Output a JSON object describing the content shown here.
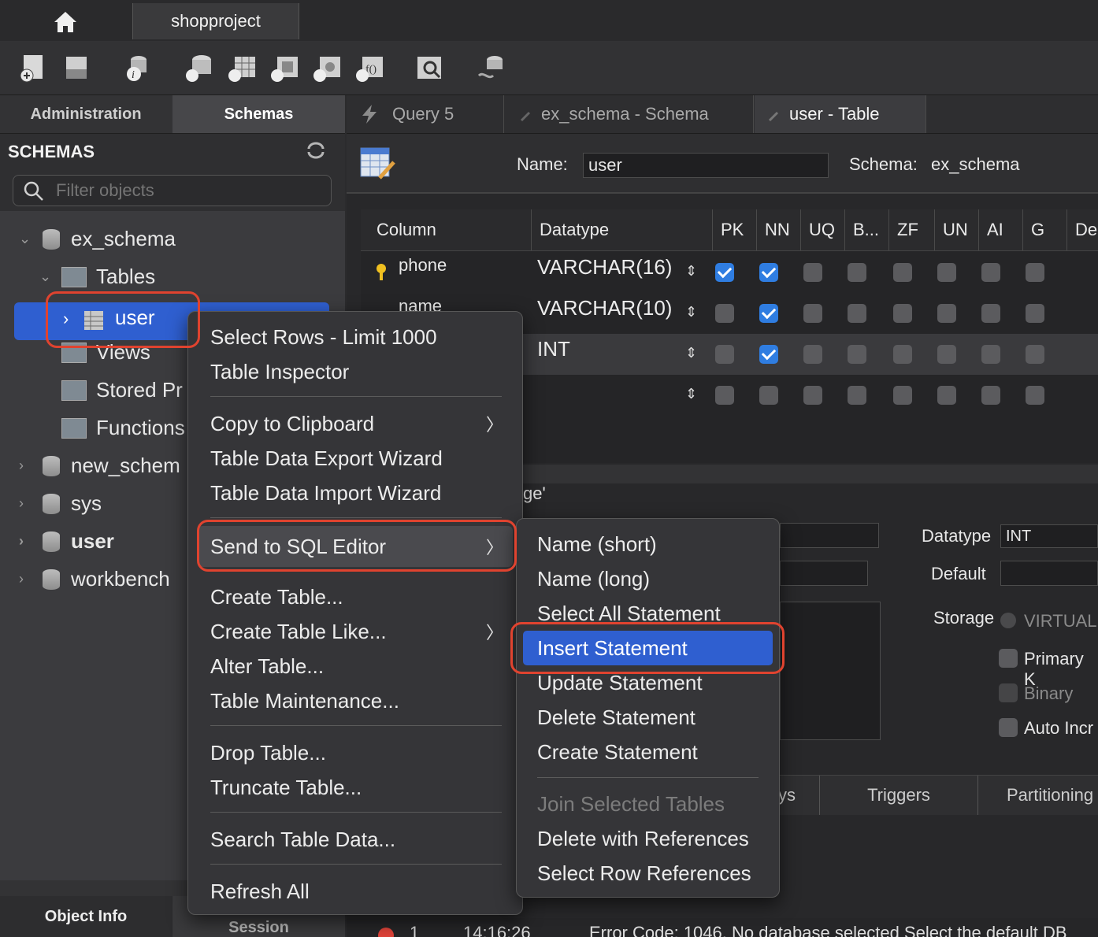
{
  "window": {
    "connection_tab": "shopproject"
  },
  "left_tabs": {
    "admin": "Administration",
    "schemas": "Schemas"
  },
  "editor_tabs": [
    "Query 5",
    "ex_schema - Schema",
    "user - Table"
  ],
  "sidebar": {
    "title": "SCHEMAS",
    "filter_placeholder": "Filter objects",
    "items": {
      "ex_schema": "ex_schema",
      "tables": "Tables",
      "user": "user",
      "views": "Views",
      "stored": "Stored Pr",
      "functions": "Functions",
      "new_schema": "new_schem",
      "sys": "sys",
      "user_db": "user",
      "workbench": "workbench"
    },
    "bottom_tabs": {
      "object_info": "Object Info",
      "session": "Session"
    }
  },
  "table_editor": {
    "name_label": "Name:",
    "name_value": "user",
    "schema_label": "Schema:",
    "schema_value": "ex_schema",
    "columns_header": [
      "Column",
      "Datatype",
      "PK",
      "NN",
      "UQ",
      "B...",
      "ZF",
      "UN",
      "AI",
      "G",
      "De"
    ],
    "rows": [
      {
        "name": "phone",
        "type": "VARCHAR(16)"
      },
      {
        "name": "name",
        "type": "VARCHAR(10)"
      },
      {
        "name": "",
        "type": "INT"
      },
      {
        "name": "",
        "type": ""
      }
    ],
    "detail_fragment": "ge'",
    "datatype_label": "Datatype",
    "datatype_value": "INT",
    "default_label": "Default",
    "storage_label": "Storage",
    "virtual_label": "VIRTUAL",
    "primary_label": "Primary K",
    "binary_label": "Binary",
    "autoincr_label": "Auto Incr",
    "bottom_tabs": [
      "ys",
      "Triggers",
      "Partitioning"
    ],
    "output_row": {
      "num": "1",
      "time": "14:16:26",
      "msg": "Error Code: 1046. No database selected Select the default DB"
    }
  },
  "context_menu": {
    "items": [
      "Select Rows - Limit 1000",
      "Table Inspector",
      "Copy to Clipboard",
      "Table Data Export Wizard",
      "Table Data Import Wizard",
      "Send to SQL Editor",
      "Create Table...",
      "Create Table Like...",
      "Alter Table...",
      "Table Maintenance...",
      "Drop Table...",
      "Truncate Table...",
      "Search Table Data...",
      "Refresh All"
    ]
  },
  "submenu": {
    "items": [
      "Name (short)",
      "Name (long)",
      "Select All Statement",
      "Insert Statement",
      "Update Statement",
      "Delete Statement",
      "Create Statement",
      "Join Selected Tables",
      "Delete with References",
      "Select Row References"
    ]
  },
  "colors": {
    "selection": "#2f5fd0",
    "highlight_box": "#e0432f",
    "check_on": "#2f7de1"
  }
}
